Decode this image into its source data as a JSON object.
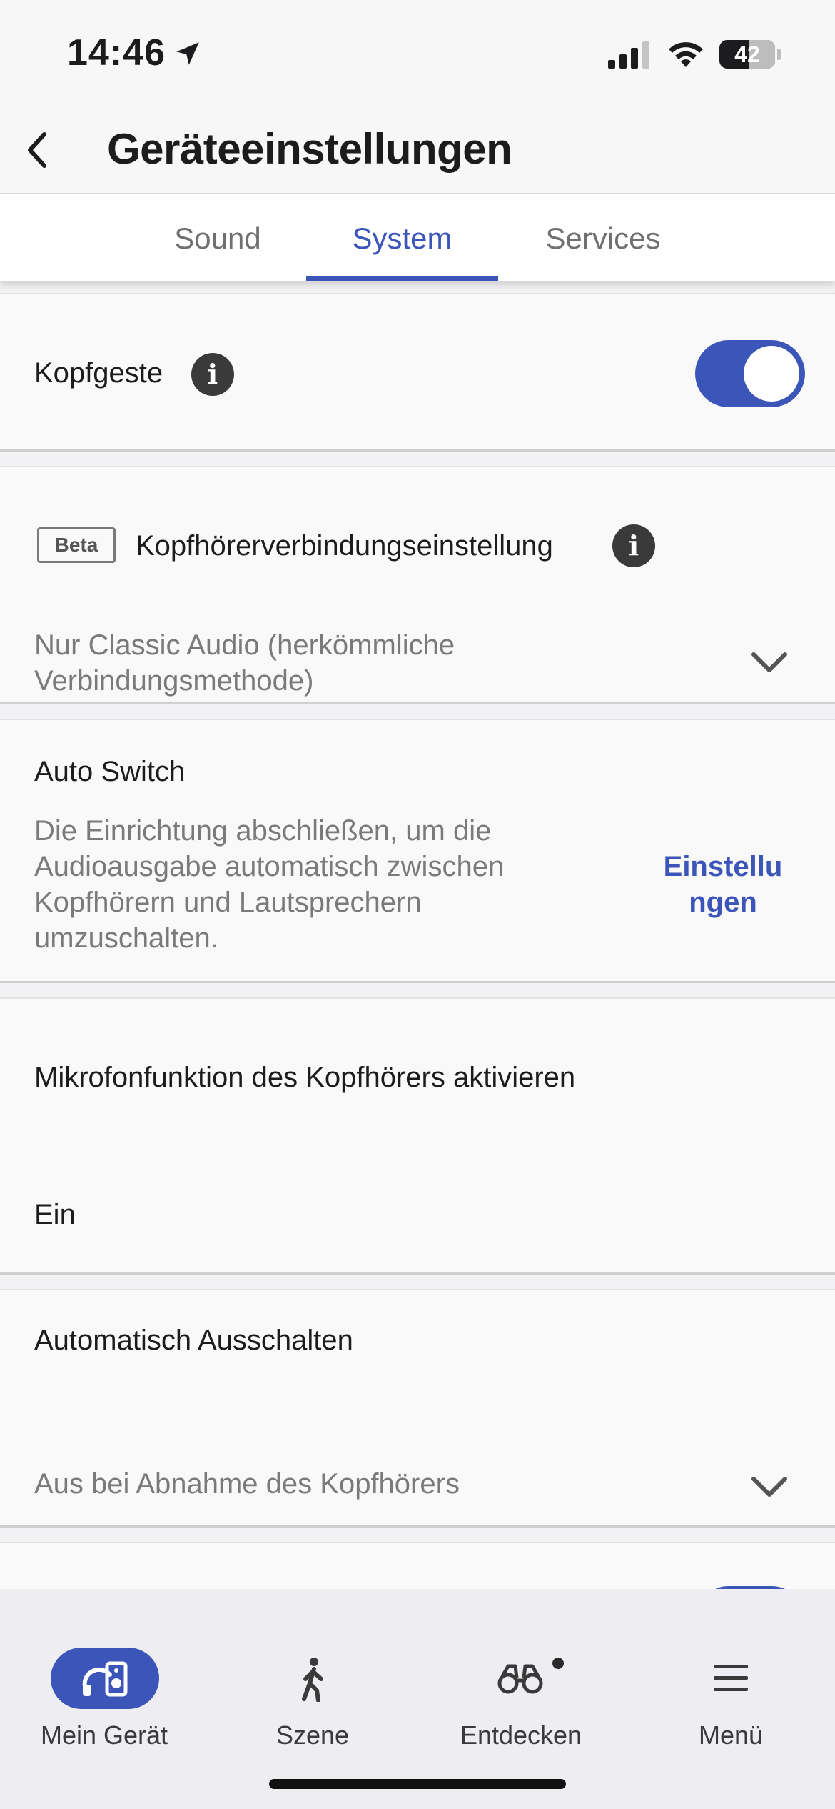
{
  "status_bar": {
    "time": "14:46",
    "battery": "42"
  },
  "header": {
    "title": "Geräteeinstellungen"
  },
  "tabs": [
    {
      "label": "Sound",
      "active": false
    },
    {
      "label": "System",
      "active": true
    },
    {
      "label": "Services",
      "active": false
    }
  ],
  "settings": {
    "kopfgeste": {
      "label": "Kopfgeste",
      "enabled": true
    },
    "connection": {
      "badge": "Beta",
      "label": "Kopfhörerverbindungseinstellung",
      "value_line1": "Nur Classic Audio (herkömmliche",
      "value_line2": "Verbindungsmethode)"
    },
    "auto_switch": {
      "label": "Auto Switch",
      "desc_line1": "Die Einrichtung abschließen, um die",
      "desc_line2": "Audioausgabe automatisch zwischen",
      "desc_line3": "Kopfhörern und Lautsprechern",
      "desc_line4": "umzuschalten.",
      "link_line1": "Einstellu",
      "link_line2": "ngen"
    },
    "mic": {
      "label": "Mikrofonfunktion des Kopfhörers aktivieren",
      "value": "Ein"
    },
    "auto_off": {
      "label": "Automatisch Ausschalten",
      "value": "Aus bei Abnahme des Kopfhörers"
    }
  },
  "bottom_nav": [
    {
      "label": "Mein Gerät",
      "icon": "headphones-speaker-icon",
      "active": true
    },
    {
      "label": "Szene",
      "icon": "walking-person-icon",
      "active": false
    },
    {
      "label": "Entdecken",
      "icon": "binoculars-icon",
      "active": false,
      "badge_dot": true
    },
    {
      "label": "Menü",
      "icon": "hamburger-menu-icon",
      "active": false
    }
  ],
  "colors": {
    "accent": "#3c55b8",
    "text": "#1c1c1e",
    "muted": "#7a7a7a"
  }
}
